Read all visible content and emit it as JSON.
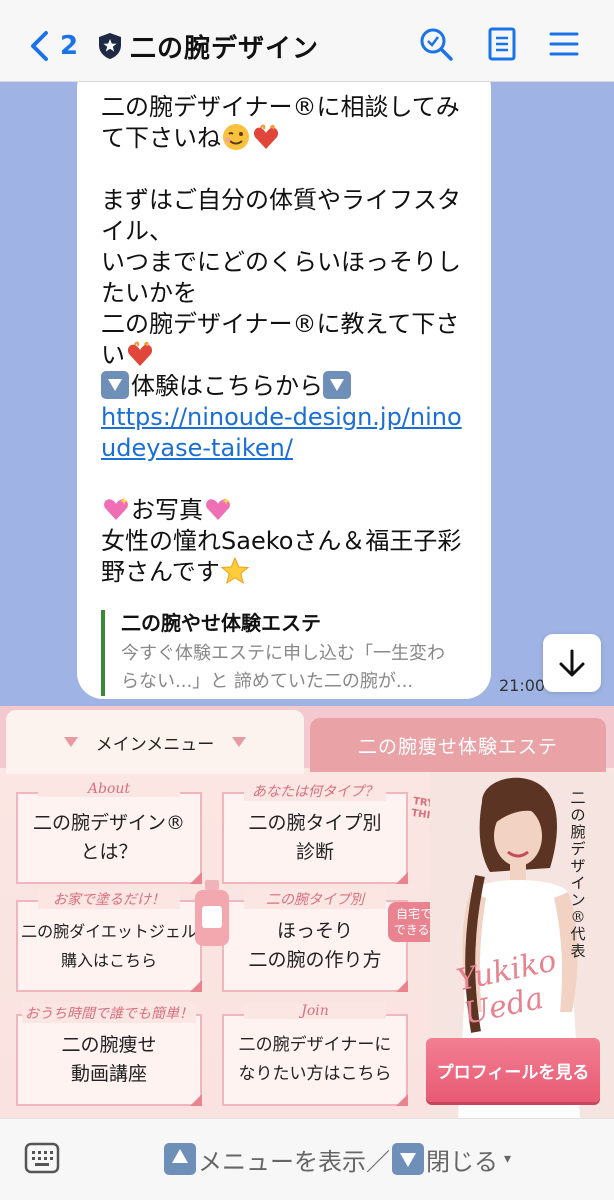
{
  "header": {
    "back_count": "2",
    "title": "二の腕デザイン",
    "icons": [
      "chevron-left-icon",
      "shield-star-icon",
      "search-icon",
      "note-icon",
      "menu-icon"
    ],
    "accent_color": "#1a73e8"
  },
  "chat": {
    "background_color": "#9fb3e4",
    "message": {
      "line1": "二の腕デザイナー®に相談してみて下さいね",
      "para2": "まずはご自分の体質やライフスタイル、\nいつまでにどのくらいほっそりしたいかを\n二の腕デザイナー®に教えて下さい",
      "trial_text": "体験はこちらから",
      "link": "https://ninoude-design.jp/ninoudeyase-taiken/",
      "photo_heading": "お写真",
      "photo_caption": "女性の憧れSaekoさん＆福王子彩野さんです"
    },
    "link_preview": {
      "title": "二の腕やせ体験エステ",
      "description": "今すぐ体験エステに申し込む「一生変わらない...」と 諦めていた二の腕が..."
    },
    "timestamp": "21:00"
  },
  "rich_menu": {
    "tab_main": "メインメニュー",
    "tab_other": "二の腕痩せ体験エステ",
    "cards": [
      {
        "tag": "About",
        "label": "二の腕デザイン®\nとは？"
      },
      {
        "tag": "あなたは何タイプ？",
        "label": "二の腕タイプ別\n診断"
      },
      {
        "tag": "お家で塗るだけ！",
        "label": "二の腕ダイエットジェル\n購入はこちら"
      },
      {
        "tag": "二の腕タイプ別",
        "label": "ほっそり\n二の腕の作り方"
      },
      {
        "tag": "おうち時間で誰でも簡単！",
        "label": "二の腕痩せ\n動画講座"
      },
      {
        "tag": "Join",
        "label": "二の腕デザイナーに\nなりたい方はこちら"
      }
    ],
    "try_this": "TRY\nTHIS!",
    "home_badge": "自宅で\nできる!",
    "vertical_title": "二の腕デザイン®代表",
    "signature": "Yukiko\nUeda",
    "profile_button": "プロフィールを見る"
  },
  "bottom_bar": {
    "menu_toggle_show": "メニューを表示",
    "separator": "／",
    "menu_toggle_close": "閉じる"
  }
}
